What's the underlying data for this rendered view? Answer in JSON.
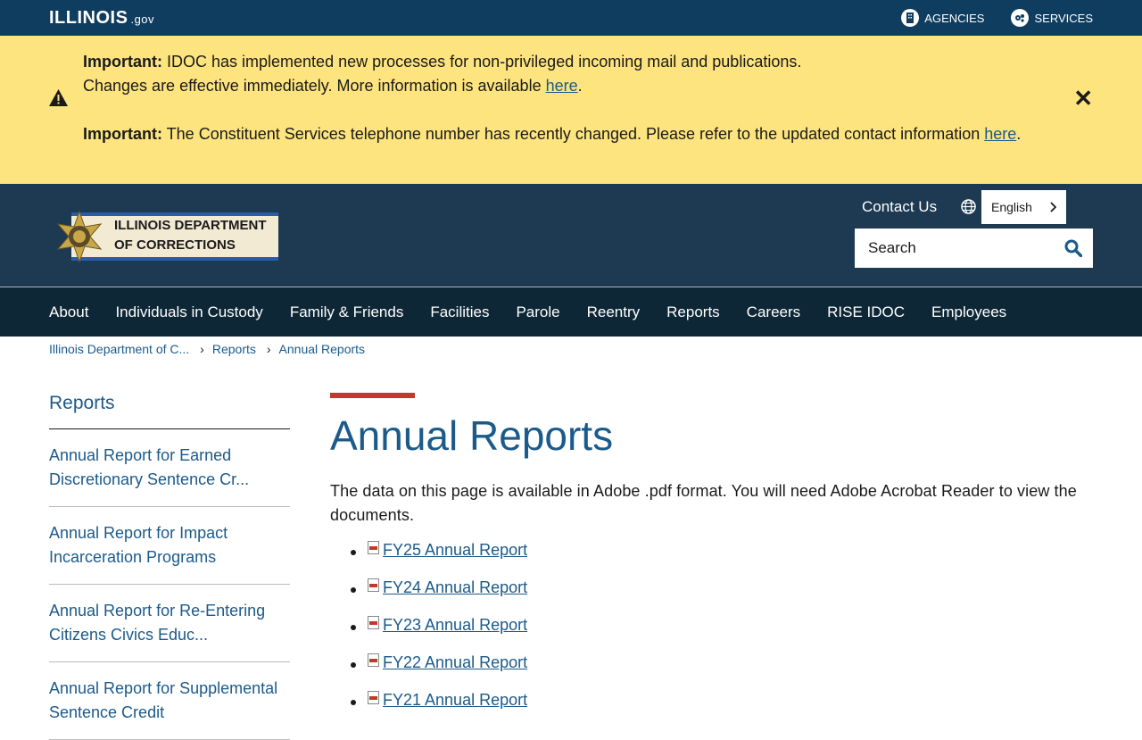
{
  "statebar": {
    "logo_text": "ILLINOIS",
    "logo_suffix": ".gov",
    "agencies_label": "AGENCIES",
    "services_label": "SERVICES"
  },
  "alert": {
    "msg1_prefix": "Important:",
    "msg1_line1": " IDOC has implemented new processes for non-privileged incoming mail and publications.",
    "msg1_line2": "Changes are effective immediately. More information is available ",
    "msg1_link": "here",
    "msg1_end": ".",
    "msg2_prefix": "Important:",
    "msg2_text": " The Constituent Services telephone number has recently changed. Please refer to the updated contact information ",
    "msg2_link": "here",
    "msg2_end": "."
  },
  "agency": {
    "logo_line1": "ILLINOIS DEPARTMENT",
    "logo_line2": "OF CORRECTIONS",
    "contact_label": "Contact Us",
    "language": "English",
    "search_placeholder": "Search"
  },
  "nav": [
    "About",
    "Individuals in Custody",
    "Family & Friends",
    "Facilities",
    "Parole",
    "Reentry",
    "Reports",
    "Careers",
    "RISE IDOC",
    "Employees"
  ],
  "breadcrumb": [
    "Illinois Department of C...",
    "Reports",
    "Annual Reports"
  ],
  "sidebar": {
    "title": "Reports",
    "items": [
      "Annual Report for Earned Discretionary Sentence Cr...",
      "Annual Report for Impact Incarceration Programs",
      "Annual Report for Re-Entering Citizens Civics Educ...",
      "Annual Report for Supplemental Sentence Credit"
    ]
  },
  "main": {
    "title": "Annual Reports",
    "intro": "The data on this page is available in Adobe .pdf format. You will need Adobe Acrobat Reader to view the documents.",
    "reports": [
      " FY25 Annual Report",
      " FY24 Annual Report",
      " FY23 Annual Report",
      " FY22 Annual Report",
      " FY21 Annual Report"
    ]
  },
  "colors": {
    "statebar_bg": "#0f3d5f",
    "alert_bg": "#fde47f",
    "agency_bg": "#1d3a52",
    "nav_bg": "#0e2736",
    "link": "#1b5a8a",
    "accent_bar": "#c0392b"
  }
}
